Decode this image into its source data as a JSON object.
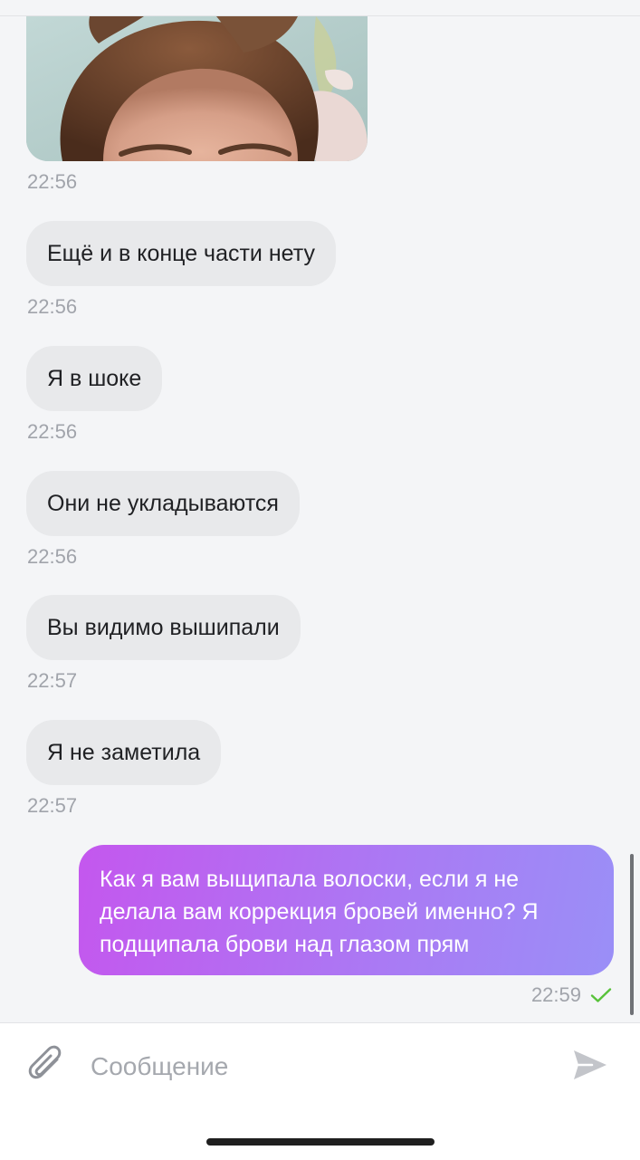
{
  "messages": [
    {
      "type": "image",
      "time": "22:56"
    },
    {
      "type": "text",
      "text": "Ещё и в конце части нету",
      "time": "22:56"
    },
    {
      "type": "text",
      "text": "Я в шоке",
      "time": "22:56"
    },
    {
      "type": "text",
      "text": "Они не укладываются",
      "time": "22:56"
    },
    {
      "type": "text",
      "text": "Вы видимо вышипали",
      "time": "22:57"
    },
    {
      "type": "text",
      "text": "Я не заметила",
      "time": "22:57"
    }
  ],
  "outgoing": {
    "lines": [
      "Как я вам выщипала волоски, если я не",
      "делала вам коррекция бровей именно? Я",
      "подщипала брови над глазом прям"
    ],
    "time": "22:59",
    "status_icon": "check-icon"
  },
  "composer": {
    "placeholder": "Сообщение",
    "attach_icon": "paperclip-icon",
    "send_icon": "send-icon"
  },
  "colors": {
    "background": "#f4f5f7",
    "incoming_bubble": "#e8e9eb",
    "outgoing_gradient_start": "#c457ee",
    "outgoing_gradient_end": "#9a8ff7",
    "read_check": "#58c23a",
    "timestamp": "#a1a4ab"
  }
}
